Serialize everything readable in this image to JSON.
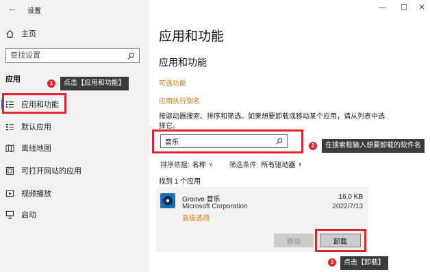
{
  "window": {
    "title": "设置",
    "back_glyph": "←",
    "minimize_glyph": "—",
    "maximize_glyph": "☐",
    "close_glyph": "✕"
  },
  "sidebar": {
    "home_label": "主页",
    "search_placeholder": "查找设置",
    "section_label": "应用",
    "items": [
      {
        "label": "应用和功能",
        "icon": "list-icon"
      },
      {
        "label": "默认应用",
        "icon": "default-apps-icon"
      },
      {
        "label": "离线地图",
        "icon": "map-icon"
      },
      {
        "label": "可打开网站的应用",
        "icon": "open-web-icon"
      },
      {
        "label": "视频播放",
        "icon": "video-icon"
      },
      {
        "label": "启动",
        "icon": "startup-icon"
      }
    ]
  },
  "main": {
    "page_title": "应用和功能",
    "section_title": "应用和功能",
    "link_optional": "可选功能",
    "link_alias": "应用执行别名",
    "description": "按驱动器搜索、排序和筛选。如果想要卸载或移动某个应用，请从列表中选择它。",
    "search_value": "音乐",
    "sort_label": "排序依据:",
    "sort_value": "名称",
    "filter_label": "筛选条件:",
    "filter_value": "所有驱动器",
    "found_text": "找到 1 个应用"
  },
  "app": {
    "name": "Groove 音乐",
    "publisher": "Microsoft Corporation",
    "advanced": "高级选项",
    "size": "16.0 KB",
    "date": "2022/7/13",
    "move_label": "移动",
    "uninstall_label": "卸载"
  },
  "annotations": {
    "step1_num": "1",
    "step1_text": "点击【应用和功能】",
    "step2_num": "2",
    "step2_text": "在搜索框输入想要卸载的软件名",
    "step3_num": "3",
    "step3_text": "点击【卸载】",
    "accent": "#e0252a"
  },
  "colors": {
    "sidebar_bg": "#f2f2f2",
    "link": "#d07a1a",
    "callout_bg": "#3b3b3b"
  }
}
